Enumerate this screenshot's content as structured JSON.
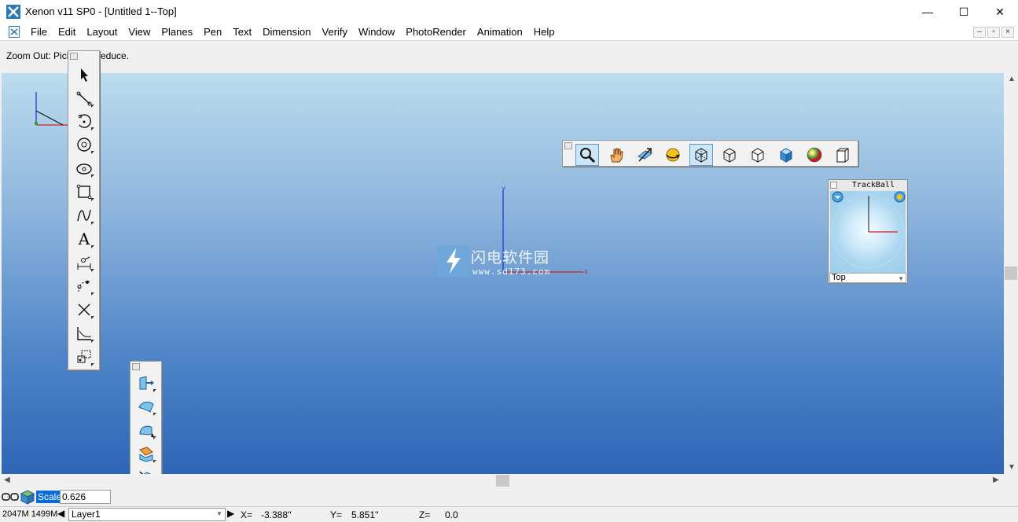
{
  "window": {
    "title": "Xenon v11 SP0 - [Untitled 1--Top]",
    "minimize": "—",
    "maximize": "☐",
    "close": "✕"
  },
  "menu": [
    "File",
    "Edit",
    "Layout",
    "View",
    "Planes",
    "Pen",
    "Text",
    "Dimension",
    "Verify",
    "Window",
    "PhotoRender",
    "Animation",
    "Help"
  ],
  "mdi_buttons": [
    "–",
    "▫",
    "×"
  ],
  "prompt": {
    "text": "Zoom Out: Pick",
    "text_end": "educe."
  },
  "left_toolbar": {
    "tools": [
      "select-arrow-icon",
      "line-icon",
      "arc-icon",
      "circle-icon",
      "ellipse-icon",
      "rectangle-icon",
      "spline-icon",
      "text-icon",
      "dimension-icon",
      "point-icon",
      "trim-icon",
      "chart-axis-icon",
      "image-frame-icon"
    ],
    "text_tool_glyph": "A"
  },
  "surface_toolbar": {
    "tools": [
      "extrude-icon",
      "surface-icon",
      "revolve-surface-icon",
      "blend-surface-icon",
      "offset-surface-icon"
    ]
  },
  "view_toolbar": {
    "tools": [
      "zoom-icon",
      "pan-hand-icon",
      "dolly-icon",
      "rotate-sphere-icon",
      "wireframe-cube-icon",
      "hidden-line-cube-icon",
      "outline-cube-icon",
      "shaded-cube-icon",
      "render-sphere-icon",
      "box-cube-icon"
    ],
    "active": [
      0,
      4
    ]
  },
  "trackball": {
    "title": "TrackBall",
    "view": "Top"
  },
  "viewport": {
    "axis_y_label": "y",
    "axis_x_label": "x"
  },
  "watermark": {
    "cn": "闪电软件园",
    "url": "www.sd173.com"
  },
  "status": {
    "scale_label": "Scale",
    "scale_value": "0.626",
    "memory": "2047M 1499M",
    "layer": "Layer1",
    "x_label": "X=",
    "x_value": "-3.388''",
    "y_label": "Y=",
    "y_value": "5.851''",
    "z_label": "Z=",
    "z_value": "0.0"
  },
  "colors": {
    "axis_y": "#1f2fd6",
    "axis_x": "#d62020",
    "active_tool": "#cde6f7"
  }
}
